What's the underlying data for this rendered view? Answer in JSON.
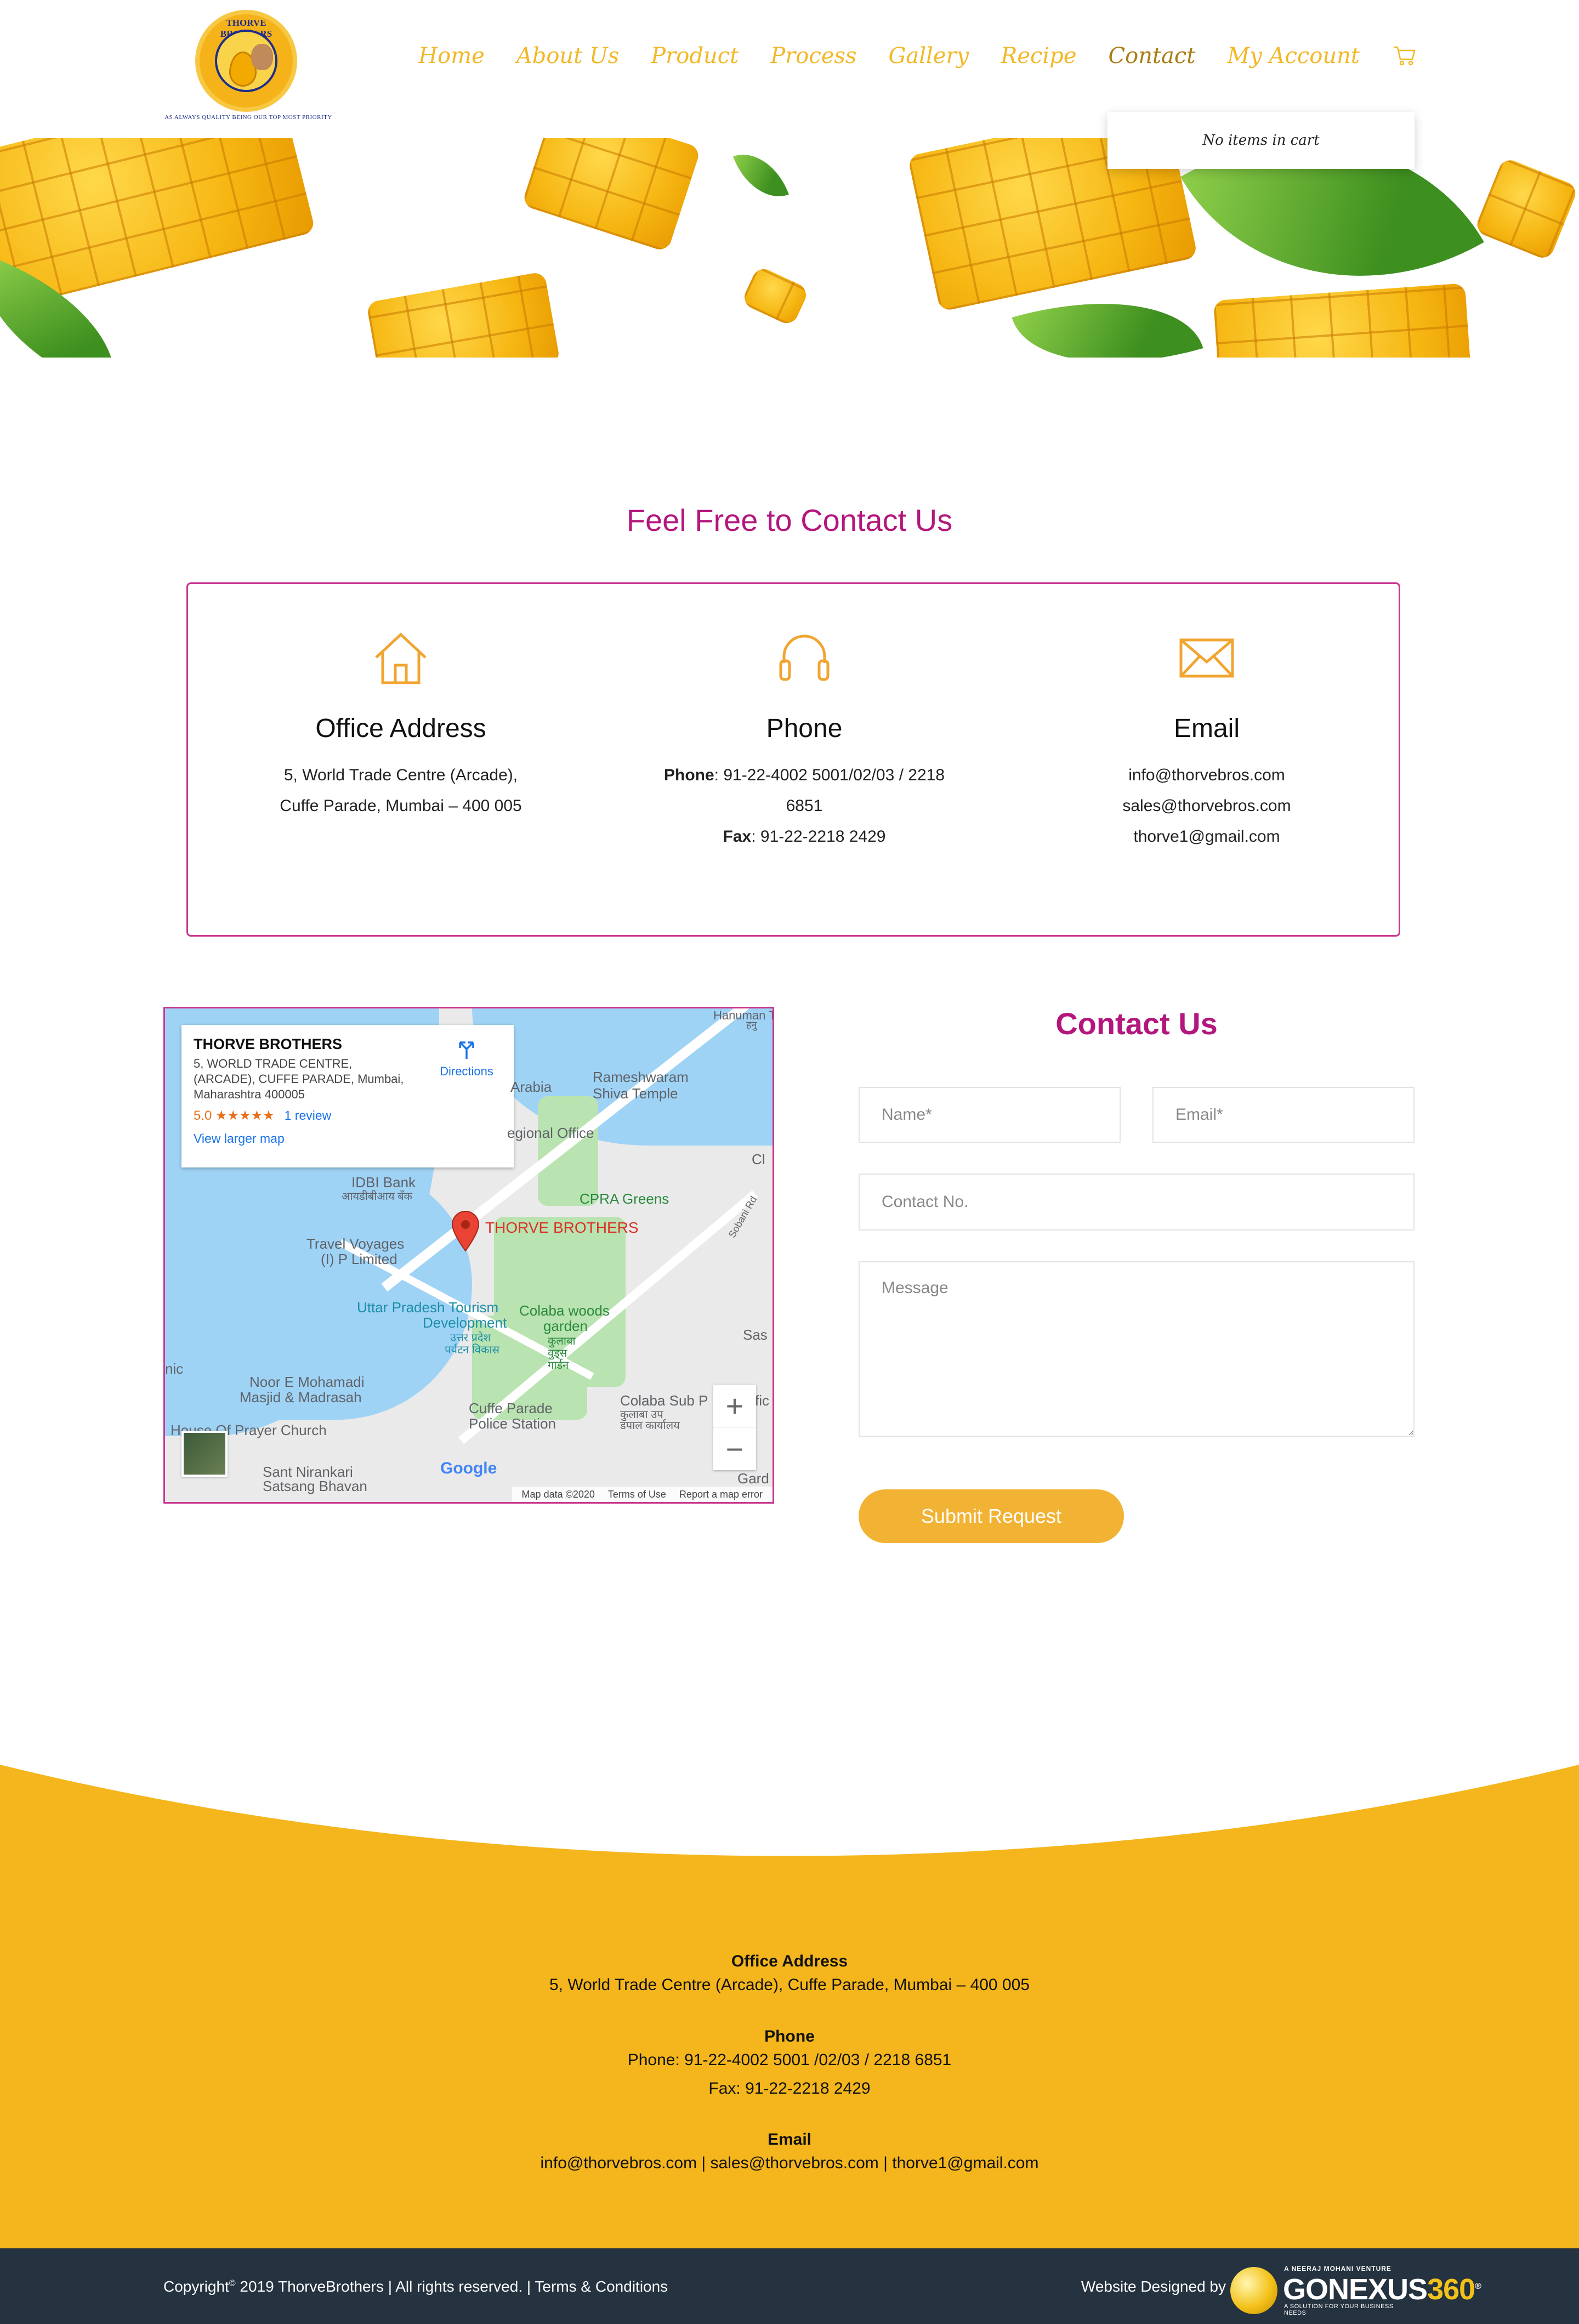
{
  "brand": {
    "logo_ring_text": "THORVE BROTHERS",
    "logo_tagline": "AS ALWAYS QUALITY BEING OUR TOP MOST PRIORITY"
  },
  "nav": {
    "items": [
      {
        "label": "Home"
      },
      {
        "label": "About Us"
      },
      {
        "label": "Product"
      },
      {
        "label": "Process"
      },
      {
        "label": "Gallery"
      },
      {
        "label": "Recipe"
      },
      {
        "label": "Contact",
        "active": true
      },
      {
        "label": "My Account"
      }
    ],
    "cart_icon": "cart-icon",
    "cart_dropdown_text": "No items in cart"
  },
  "contact_info": {
    "title": "Feel Free to Contact Us",
    "office": {
      "icon": "house-icon",
      "heading": "Office Address",
      "lines": [
        "5, World Trade Centre (Arcade),",
        "Cuffe Parade, Mumbai – 400 005"
      ]
    },
    "phone": {
      "icon": "headphones-icon",
      "heading": "Phone",
      "phone_label": "Phone",
      "phone_value": ": 91-22-4002 5001/02/03 / 2218",
      "phone_value_cont": "6851",
      "fax_label": "Fax",
      "fax_value": ": 91-22-2218 2429"
    },
    "email": {
      "icon": "envelope-icon",
      "heading": "Email",
      "lines": [
        "info@thorvebros.com",
        "sales@thorvebros.com",
        "thorve1@gmail.com"
      ]
    }
  },
  "map": {
    "card_title": "THORVE BROTHERS",
    "card_address": "5, WORLD TRADE CENTRE, (ARCADE), CUFFE PARADE, Mumbai, Maharashtra 400005",
    "rating": "5.0 ★★★★★",
    "review_link": "1 review",
    "larger_map_link": "View larger map",
    "directions": "Directions",
    "pin_label": "THORVE BROTHERS",
    "labels": {
      "arabia": "Arabia",
      "rameshwaram": "Rameshwaram",
      "shiva_temple": "Shiva Temple",
      "regional_office": "egional Office",
      "idbi": "IDBI Bank",
      "idbi_hi": "आयडीबीआय बँक",
      "cpra": "CPRA Greens",
      "travel1": "Travel Voyages",
      "travel2": "(I) P Limited",
      "uptourism1": "Uttar Pradesh Tourism",
      "uptourism2": "Development",
      "uptourism3": "उत्तर प्रदेश",
      "uptourism4": "पर्यटन विकास",
      "colaba1": "Colaba woods",
      "colaba2": "garden",
      "colaba3": "कुलाबा",
      "colaba4": "वुड्स",
      "colaba5": "गार्डन",
      "noor1": "Noor E Mohamadi",
      "noor2": "Masjid & Madrasah",
      "prayer": "House Of Prayer Church",
      "cuffe1": "Cuffe Parade",
      "cuffe2": "Police Station",
      "colabasub1": "Colaba Sub P",
      "colabasub2": "कुलाबा उप",
      "colabasub3": "डपाल कार्यालय",
      "sant1": "Sant Nirankari",
      "sant2": "Satsang Bhavan",
      "sobani": "Sobani Rd",
      "hanuman": "Hanuman T",
      "hanuman_hi": "हनु",
      "cl": "Cl",
      "sas": "Sas",
      "fic": "fic",
      "gard": "Gard",
      "nic": "nic"
    },
    "google": "Google",
    "footer_data": "Map data ©2020",
    "footer_terms": "Terms of Use",
    "footer_report": "Report a map error",
    "zoom_in": "+",
    "zoom_out": "−"
  },
  "form": {
    "title": "Contact Us",
    "name_placeholder": "Name*",
    "email_placeholder": "Email*",
    "contact_placeholder": "Contact No.",
    "message_placeholder": "Message",
    "submit_label": "Submit Request"
  },
  "footer": {
    "office_heading": "Office Address",
    "office_line": "5, World Trade Centre (Arcade), Cuffe Parade, Mumbai – 400 005",
    "phone_heading": "Phone",
    "phone_line": "Phone: 91-22-4002 5001 /02/03 / 2218 6851",
    "fax_line": "Fax: 91-22-2218 2429",
    "email_heading": "Email",
    "email_line": "info@thorvebros.com | sales@thorvebros.com | thorve1@gmail.com",
    "copyright_pre": "Copyright",
    "copyright_sup": "©",
    "copyright_post": " 2019 ThorveBrothers | All rights reserved. | ",
    "terms_link": "Terms & Conditions",
    "designed_by": "Website Designed by",
    "gn_top": "A NEERAJ MOHANI VENTURE",
    "gn_word_a": "GONEXUS",
    "gn_word_b": "360",
    "gn_reg": "®",
    "gn_sub": "A SOLUTION FOR YOUR BUSINESS NEEDS"
  },
  "colors": {
    "accent_yellow": "#f4b61c",
    "magenta": "#b3167d",
    "border_magenta": "#c9368f",
    "footer_dark": "#25323f",
    "icon_orange": "#f1a531"
  }
}
